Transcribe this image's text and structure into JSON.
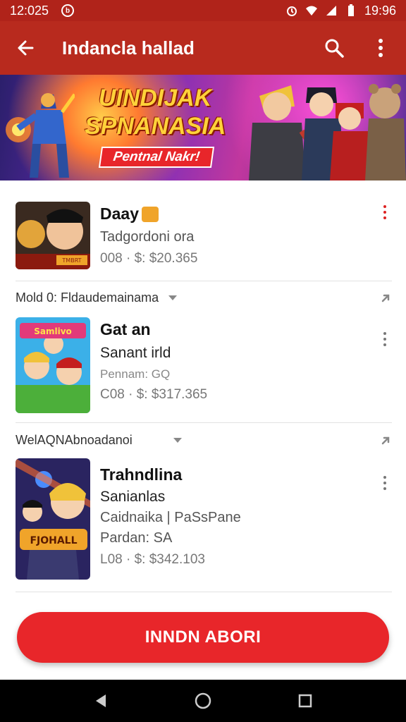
{
  "status_bar": {
    "time": "12:025",
    "notification_icon": "b-circle-icon",
    "battery_time": "19:96"
  },
  "app_bar": {
    "title": "Indancla hallad",
    "back_icon": "arrow-left-icon",
    "search_icon": "search-icon",
    "more_icon": "more-vertical-icon"
  },
  "banner": {
    "title_line1": "UINDIJAK",
    "title_line2": "SPNANASIA",
    "tag": "Pentnal Nakr!"
  },
  "items": [
    {
      "title": "Daay",
      "line1": "Tadgordoni ora",
      "price": "008 · $: $20.365"
    },
    {
      "title": "Gat an",
      "line1": "Sanant irld",
      "line2": "Pennam: GQ",
      "price": "C08 · $: $317.365"
    },
    {
      "title": "Trahndlina",
      "line1": "Sanianlas",
      "line2": "Caidnaika | PaSsPane",
      "line3": "Pardan: SA",
      "price": "L08 · $: $342.103"
    }
  ],
  "sections": [
    {
      "label": "Mold 0: Fldaudemainama"
    },
    {
      "label": "WelAQNAbnoadanoi"
    }
  ],
  "thumb_labels": {
    "item1": "TMBRT",
    "item2": "Samlivo",
    "item3": "FJOHALL"
  },
  "cta": {
    "label": "INNDN ABORI"
  },
  "colors": {
    "app_bar": "#b82a1e",
    "status_bar": "#b0231a",
    "cta": "#e8262a",
    "accent_red": "#d22222"
  }
}
